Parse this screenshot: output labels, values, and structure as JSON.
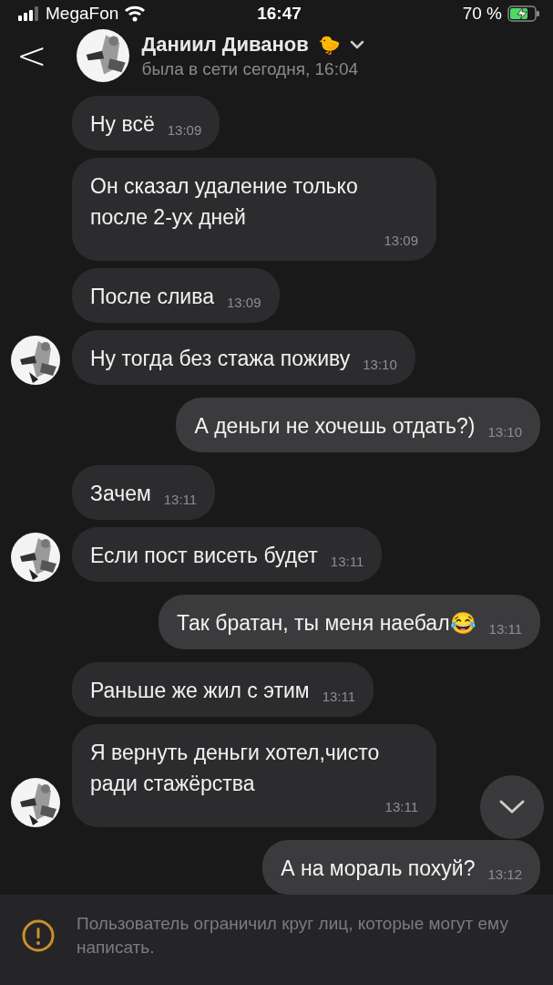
{
  "status_bar": {
    "carrier": "MegaFon",
    "time": "16:47",
    "battery": "70 %",
    "charging": true
  },
  "header": {
    "back": "<",
    "name": "Даниил Диванов",
    "status_emoji": "🐤",
    "last_seen": "была в сети сегодня, 16:04"
  },
  "messages": [
    {
      "kind": "incoming",
      "text": "Ну всё",
      "time": "13:09",
      "avatar": false
    },
    {
      "kind": "incoming",
      "text": "Он сказал удаление только после 2-ух дней",
      "time": "13:09",
      "avatar": false
    },
    {
      "kind": "incoming",
      "text": "После слива",
      "time": "13:09",
      "avatar": false
    },
    {
      "kind": "incoming",
      "text": "Ну тогда без стажа поживу",
      "time": "13:10",
      "avatar": true
    },
    {
      "kind": "outgoing",
      "text": "А деньги не хочешь отдать?)",
      "time": "13:10"
    },
    {
      "kind": "incoming",
      "text": "Зачем",
      "time": "13:11",
      "avatar": false
    },
    {
      "kind": "incoming",
      "text": "Если пост висеть будет",
      "time": "13:11",
      "avatar": true
    },
    {
      "kind": "outgoing",
      "text": "Так братан, ты меня наебал😂",
      "time": "13:11"
    },
    {
      "kind": "incoming",
      "text": "Раньше же жил с этим",
      "time": "13:11",
      "avatar": false
    },
    {
      "kind": "incoming",
      "text": "Я вернуть деньги хотел,чисто ради стажёрства",
      "time": "13:11",
      "avatar": true
    },
    {
      "kind": "outgoing",
      "text": "А на мораль похуй?",
      "time": "13:12"
    }
  ],
  "notice": {
    "text": "Пользователь ограничил круг лиц, которые могут ему написать."
  }
}
